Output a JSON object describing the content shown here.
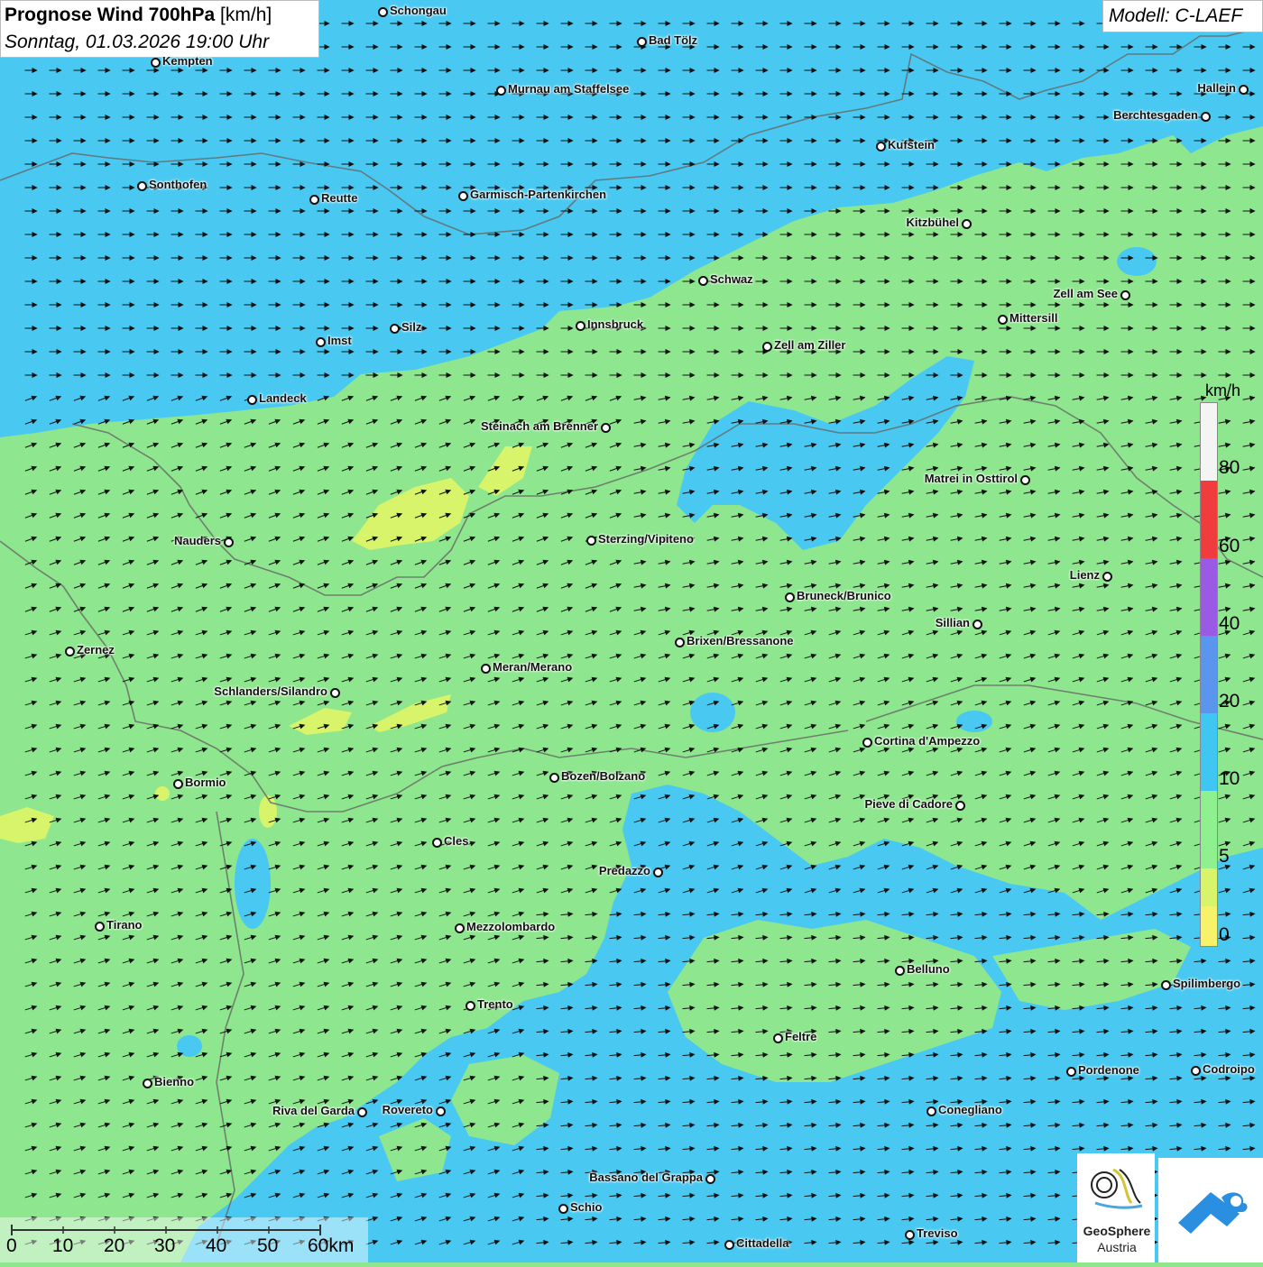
{
  "title": {
    "bold": "Prognose Wind 700hPa",
    "unit": "[km/h]",
    "subtitle": "Sonntag, 01.03.2026 19:00 Uhr"
  },
  "model": "Modell: C-LAEF",
  "legend": {
    "unit": "km/h",
    "labels": [
      "80",
      "60",
      "40",
      "20",
      "10",
      "5",
      "0"
    ],
    "colors": {
      "above80": "#f4f4f4",
      "c80": "#f03c3c",
      "c60": "#9a5ae6",
      "c40": "#5a96ee",
      "c20": "#40c6f2",
      "c10": "#8ef08e",
      "c5": "#d8f46a",
      "c0": "#f8f26a"
    }
  },
  "scale_bar": [
    "0",
    "10",
    "20",
    "30",
    "40",
    "50",
    "60km"
  ],
  "logos": {
    "geosphere_line1": "GeoSphere",
    "geosphere_line2": "Austria"
  },
  "cities": [
    "Schongau",
    "Bad Tölz",
    "Kempten",
    "Murnau am Staffelsee",
    "Hallein",
    "Berchtesgaden",
    "Kufstein",
    "Sonthofen",
    "Reutte",
    "Garmisch-Partenkirchen",
    "Kitzbühel",
    "Zell am See",
    "Schwaz",
    "Mittersill",
    "Innsbruck",
    "Imst",
    "Silz",
    "Zell am Ziller",
    "Landeck",
    "Steinach am Brenner",
    "Matrei in Osttirol",
    "Nauders",
    "Sterzing/Vipiteno",
    "Lienz",
    "Bruneck/Brunico",
    "Sillian",
    "Zernez",
    "Brixen/Bressanone",
    "Meran/Merano",
    "Schlanders/Silandro",
    "Cortina d'Ampezzo",
    "Bozen/Bolzano",
    "Bormio",
    "Pieve di Cadore",
    "Cles",
    "Predazzo",
    "Tirano",
    "Mezzolombardo",
    "Belluno",
    "Spilimbergo",
    "Trento",
    "Feltre",
    "Pordenone",
    "Codroipo",
    "Bienno",
    "Riva del Garda",
    "Rovereto",
    "Conegliano",
    "Bassano del Grappa",
    "Schio",
    "Treviso",
    "Cittadella"
  ],
  "wind_field": {
    "predominant_direction": "west-to-east",
    "north_part": "from west",
    "south_part": "from southwest"
  }
}
